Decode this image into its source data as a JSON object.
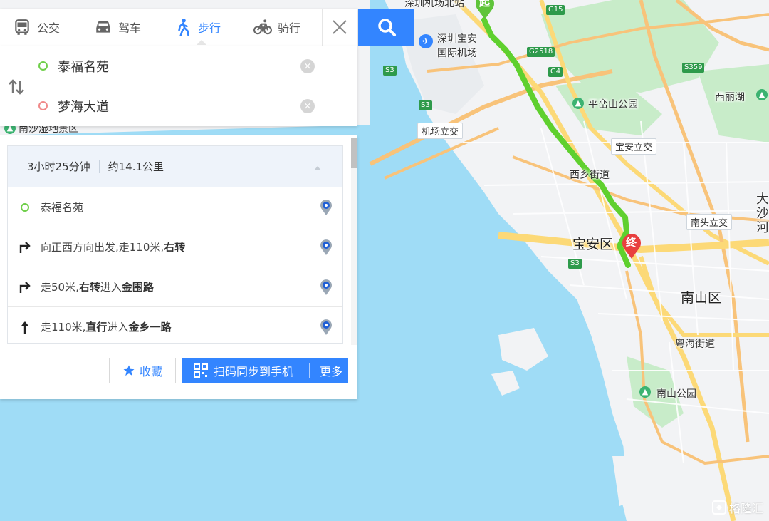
{
  "tabs": [
    {
      "label": "公交",
      "icon": "bus-icon"
    },
    {
      "label": "驾车",
      "icon": "car-icon"
    },
    {
      "label": "步行",
      "icon": "walk-icon",
      "active": true
    },
    {
      "label": "骑行",
      "icon": "bike-icon"
    }
  ],
  "route": {
    "start": "泰福名苑",
    "end": "梦海大道"
  },
  "summary": {
    "duration": "3小时25分钟",
    "distance": "约14.1公里"
  },
  "steps": [
    {
      "icon": "start-dot-icon",
      "parts": [
        {
          "t": "泰福名苑",
          "b": false
        }
      ]
    },
    {
      "icon": "turn-right-icon",
      "parts": [
        {
          "t": "向正西方向出发,走110米,",
          "b": false
        },
        {
          "t": "右转",
          "b": true
        }
      ]
    },
    {
      "icon": "turn-right-icon",
      "parts": [
        {
          "t": "走50米,",
          "b": false
        },
        {
          "t": "右转",
          "b": true
        },
        {
          "t": "进入",
          "b": false
        },
        {
          "t": "金围路",
          "b": true
        }
      ]
    },
    {
      "icon": "straight-icon",
      "parts": [
        {
          "t": "走110米,",
          "b": false
        },
        {
          "t": "直行",
          "b": true
        },
        {
          "t": "进入",
          "b": false
        },
        {
          "t": "金乡一路",
          "b": true
        }
      ]
    }
  ],
  "actions": {
    "favorite": "收藏",
    "sync": "扫码同步到手机",
    "more": "更多"
  },
  "map": {
    "labels": {
      "airport_top": "深圳机场北站",
      "airport_1": "深圳宝安",
      "airport_2": "国际机场",
      "pingluan_park": "平峦山公园",
      "xili_lake": "西丽湖",
      "airport_interchange": "机场立交",
      "baoan_interchange": "宝安立交",
      "xixiang_street": "西乡街道",
      "nantou_interchange": "南头立交",
      "baoan_district": "宝安区",
      "nanshan_district": "南山区",
      "yuehai_street": "粤海街道",
      "nanshan_park": "南山公园",
      "wetland": "南沙湿地景区",
      "edge_1": "大",
      "edge_2": "沙",
      "edge_3": "河"
    },
    "shields": {
      "g15": "G15",
      "g2518": "G2518",
      "g4": "G4",
      "s3a": "S3",
      "s3b": "S3",
      "s3c": "S3",
      "s359": "S359"
    },
    "start_marker": "起",
    "end_marker": "终"
  },
  "watermark": "格隆汇",
  "colors": {
    "accent": "#3385ff",
    "route": "#5fd02e",
    "sea": "#9fdcf6",
    "land": "#f2f3f5",
    "green": "#c8ecc9",
    "road_yellow": "#fcd977",
    "road_orange": "#f8c37a"
  }
}
